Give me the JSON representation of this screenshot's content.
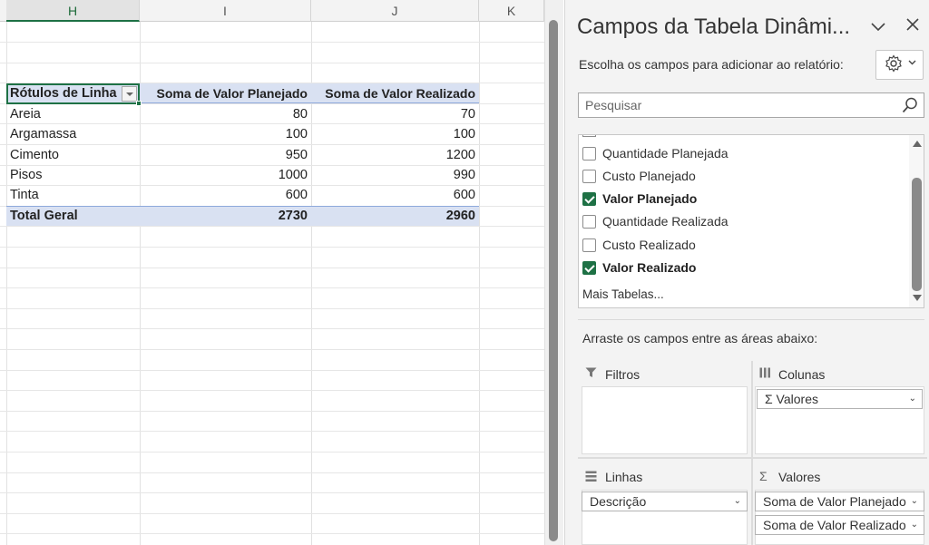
{
  "spreadsheet": {
    "columns": [
      "H",
      "I",
      "J",
      "K"
    ],
    "active_column": "H",
    "pivot": {
      "headers": [
        "Rótulos de Linha",
        "Soma de Valor Planejado",
        "Soma de Valor Realizado"
      ],
      "rows": [
        {
          "label": "Areia",
          "planejado": "80",
          "realizado": "70"
        },
        {
          "label": "Argamassa",
          "planejado": "100",
          "realizado": "100"
        },
        {
          "label": "Cimento",
          "planejado": "950",
          "realizado": "1200"
        },
        {
          "label": "Pisos",
          "planejado": "1000",
          "realizado": "990"
        },
        {
          "label": "Tinta",
          "planejado": "600",
          "realizado": "600"
        }
      ],
      "total": {
        "label": "Total Geral",
        "planejado": "2730",
        "realizado": "2960"
      }
    }
  },
  "pane": {
    "title": "Campos da Tabela Dinâmi...",
    "subtitle": "Escolha os campos para adicionar ao relatório:",
    "search_placeholder": "Pesquisar",
    "fields": [
      {
        "label": "Quantidade Planejada",
        "checked": false
      },
      {
        "label": "Custo Planejado",
        "checked": false
      },
      {
        "label": "Valor Planejado",
        "checked": true
      },
      {
        "label": "Quantidade Realizada",
        "checked": false
      },
      {
        "label": "Custo Realizado",
        "checked": false
      },
      {
        "label": "Valor Realizado",
        "checked": true
      }
    ],
    "more_tables": "Mais Tabelas...",
    "drag_hint": "Arraste os campos entre as áreas abaixo:",
    "areas": {
      "filters": {
        "title": "Filtros",
        "items": []
      },
      "columns": {
        "title": "Colunas",
        "items": [
          "Σ Valores"
        ]
      },
      "rows": {
        "title": "Linhas",
        "items": [
          "Descrição"
        ]
      },
      "values": {
        "title": "Valores",
        "items": [
          "Soma de Valor Planejado",
          "Soma de Valor Realizado"
        ]
      }
    },
    "icons": {
      "collapse": "chevron-down-icon",
      "close": "close-icon",
      "settings": "gear-icon",
      "search": "search-icon"
    },
    "accent_color": "#1e7145"
  }
}
